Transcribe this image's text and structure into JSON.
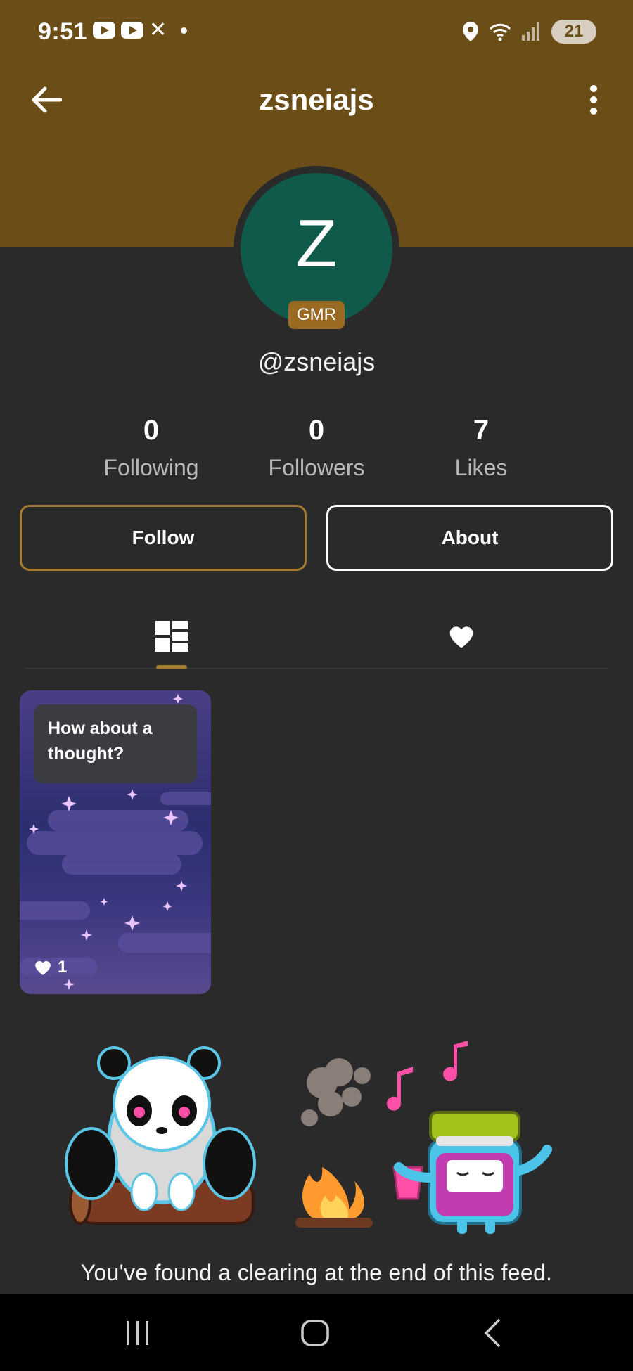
{
  "status_bar": {
    "time": "9:51",
    "battery": "21"
  },
  "header": {
    "title": "zsneiajs",
    "back_icon": "arrow-left-icon",
    "menu_icon": "more-vertical-icon"
  },
  "profile": {
    "avatar_letter": "Z",
    "badge": "GMR",
    "handle": "@zsneiajs",
    "colors": {
      "header": "#6b4d18",
      "avatar": "#0f5a4a",
      "accent": "#a37a2e"
    }
  },
  "stats": [
    {
      "value": "0",
      "label": "Following"
    },
    {
      "value": "0",
      "label": "Followers"
    },
    {
      "value": "7",
      "label": "Likes"
    }
  ],
  "actions": {
    "follow_label": "Follow",
    "about_label": "About"
  },
  "tabs": [
    {
      "icon": "grid-icon",
      "active": true
    },
    {
      "icon": "heart-icon",
      "active": false
    }
  ],
  "posts": [
    {
      "text": "How about a thought?",
      "likes": "1"
    }
  ],
  "feed_end": {
    "message": "You've found a clearing at the end of this feed."
  }
}
